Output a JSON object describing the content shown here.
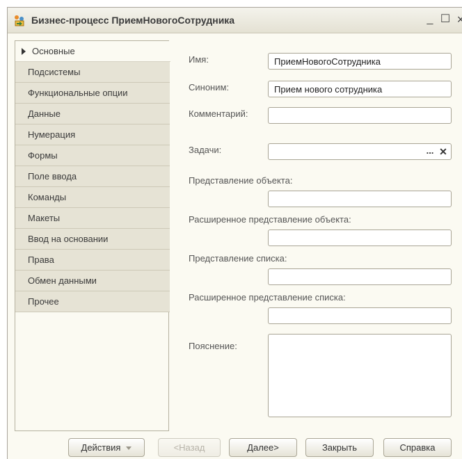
{
  "window": {
    "title": "Бизнес-процесс ПриемНовогоСотрудника",
    "minimize": "_",
    "maximize": "☐",
    "close": "×"
  },
  "nav": {
    "items": [
      {
        "label": "Основные",
        "active": true
      },
      {
        "label": "Подсистемы"
      },
      {
        "label": "Функциональные опции"
      },
      {
        "label": "Данные"
      },
      {
        "label": "Нумерация"
      },
      {
        "label": "Формы"
      },
      {
        "label": "Поле ввода"
      },
      {
        "label": "Команды"
      },
      {
        "label": "Макеты"
      },
      {
        "label": "Ввод на основании"
      },
      {
        "label": "Права"
      },
      {
        "label": "Обмен данными"
      },
      {
        "label": "Прочее"
      }
    ]
  },
  "form": {
    "name_label": "Имя:",
    "name_value": "ПриемНовогоСотрудника",
    "synonym_label": "Синоним:",
    "synonym_value": "Прием нового сотрудника",
    "comment_label": "Комментарий:",
    "comment_value": "",
    "tasks_label": "Задачи:",
    "tasks_value": "",
    "tasks_pick": "...",
    "tasks_clear": "✕",
    "object_repr_label": "Представление объекта:",
    "object_repr_value": "",
    "ext_object_repr_label": "Расширенное представление объекта:",
    "ext_object_repr_value": "",
    "list_repr_label": "Представление списка:",
    "list_repr_value": "",
    "ext_list_repr_label": "Расширенное представление списка:",
    "ext_list_repr_value": "",
    "explanation_label": "Пояснение:",
    "explanation_value": ""
  },
  "buttons": {
    "actions": "Действия",
    "back": "<Назад",
    "next": "Далее>",
    "close": "Закрыть",
    "help": "Справка"
  },
  "colors": {
    "background": "#fbfaf2",
    "nav_inactive": "#e6e3d5",
    "border": "#a9a595"
  }
}
